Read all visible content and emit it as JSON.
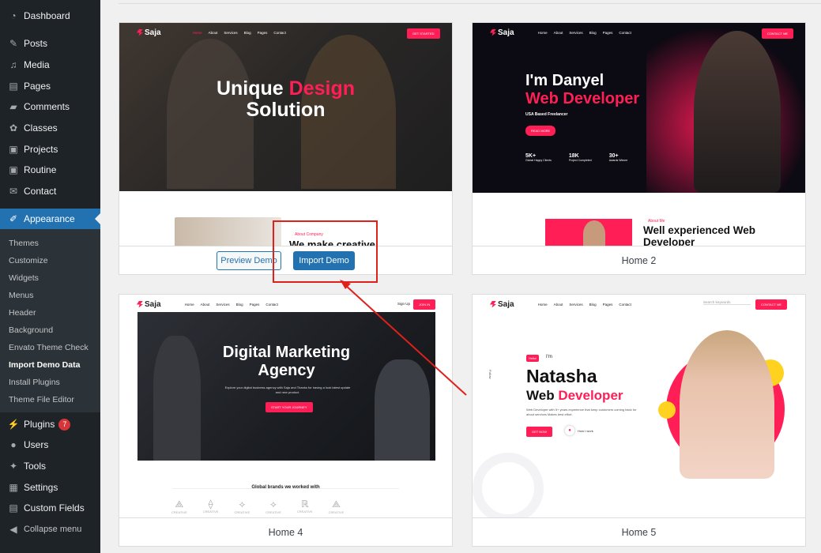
{
  "sidebar": {
    "items": [
      {
        "label": "Dashboard",
        "icon": "dashboard-icon"
      },
      {
        "label": "Posts",
        "icon": "pin-icon"
      },
      {
        "label": "Media",
        "icon": "media-icon"
      },
      {
        "label": "Pages",
        "icon": "pages-icon"
      },
      {
        "label": "Comments",
        "icon": "comments-icon"
      },
      {
        "label": "Classes",
        "icon": "gear-icon"
      },
      {
        "label": "Projects",
        "icon": "portfolio-icon"
      },
      {
        "label": "Routine",
        "icon": "image-icon"
      },
      {
        "label": "Contact",
        "icon": "mail-icon"
      },
      {
        "label": "Appearance",
        "icon": "brush-icon"
      }
    ],
    "submenu": [
      "Themes",
      "Customize",
      "Widgets",
      "Menus",
      "Header",
      "Background",
      "Envato Theme Check",
      "Import Demo Data",
      "Install Plugins",
      "Theme File Editor"
    ],
    "lower": [
      {
        "label": "Plugins",
        "icon": "plugin-icon",
        "badge": "7"
      },
      {
        "label": "Users",
        "icon": "user-icon"
      },
      {
        "label": "Tools",
        "icon": "wrench-icon"
      },
      {
        "label": "Settings",
        "icon": "settings-icon"
      },
      {
        "label": "Custom Fields",
        "icon": "table-icon"
      },
      {
        "label": "Collapse menu",
        "icon": "collapse-icon"
      }
    ]
  },
  "demos": {
    "card1": {
      "brand": "Saja",
      "nav": [
        "Home",
        "About",
        "Services",
        "Blog",
        "Pages",
        "Contact"
      ],
      "cta": "GET STARTED",
      "heading_a": "Unique",
      "heading_b": "Design",
      "heading_c": "Solution",
      "about_tag": "About Company",
      "about_title": "We make creative",
      "preview_label": "Preview Demo",
      "import_label": "Import Demo"
    },
    "card2": {
      "brand": "Saja",
      "nav": [
        "Home",
        "About",
        "Services",
        "Blog",
        "Pages",
        "Contact"
      ],
      "cta": "CONTACT ME",
      "line1": "I'm Danyel",
      "line2": "Web Developer",
      "sub": "USA Based Freelancer",
      "btn": "READ MORE",
      "stats": [
        {
          "n": "5K+",
          "l": "Global Happy Clients"
        },
        {
          "n": "18K",
          "l": "Project Completed"
        },
        {
          "n": "30+",
          "l": "Awards Winner"
        }
      ],
      "about_tag": "About Me",
      "about_title": "Well experienced Web Developer",
      "name": "Home 2"
    },
    "card4": {
      "brand": "Saja",
      "nav": [
        "Home",
        "About",
        "Services",
        "Blog",
        "Pages",
        "Contact"
      ],
      "signup": "Sign Up",
      "cta": "JOIN IN",
      "line1": "Digital Marketing",
      "line2": "Agency",
      "desc": "Explore your digital business agency with Saja and Thanks for having a look latest update and new product.",
      "btn": "START YOUR JOURNEY",
      "brands_title": "Global brands we worked with",
      "brand_names": [
        "CREATIVE",
        "CREATIVE",
        "CREATIVE",
        "CREATIVE",
        "CREATIVE",
        "CREATIVE"
      ],
      "name": "Home 4"
    },
    "card5": {
      "brand": "Saja",
      "nav": [
        "Home",
        "About",
        "Services",
        "Blog",
        "Pages",
        "Contact"
      ],
      "search": "Search keywords",
      "cta": "CONTACT ME",
      "hello": "Hello!",
      "im": "I'm",
      "line1": "Natasha",
      "line2a": "Web",
      "line2b": "Developer",
      "desc": "Web Developer with 5+ years experience that keep customers coming back for about services Makes best effort.",
      "btn": "GET NOW",
      "play": "How I work",
      "follow": "Follow",
      "name": "Home 5"
    }
  },
  "colors": {
    "accent": "#ff1e56",
    "wp_blue": "#2271b1",
    "annotation": "#e0201b"
  }
}
